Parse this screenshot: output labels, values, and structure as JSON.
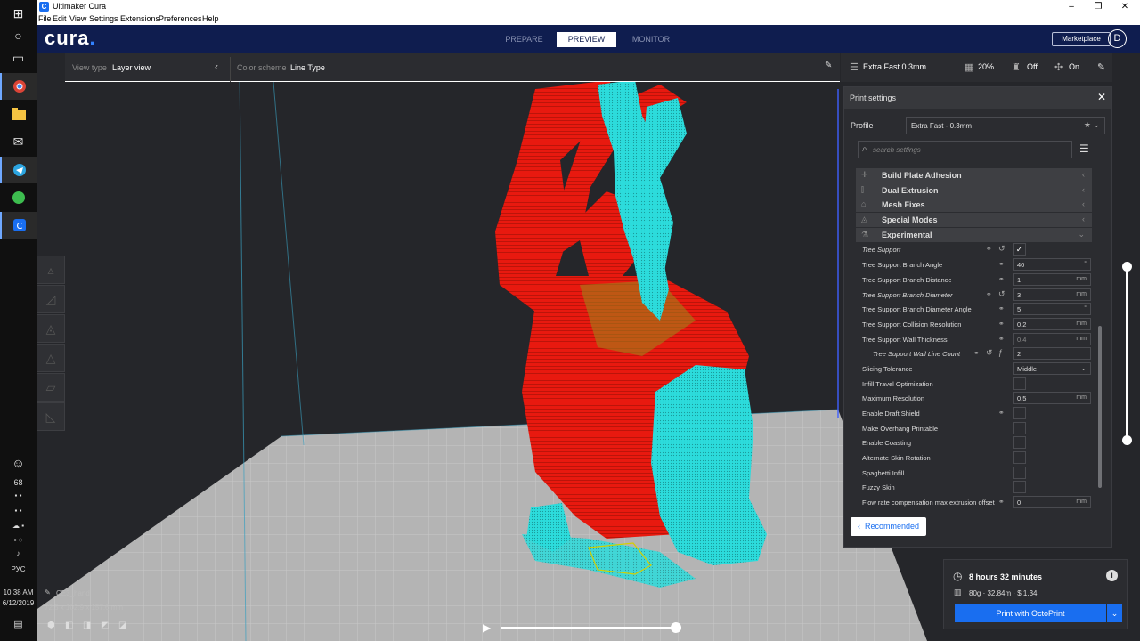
{
  "window": {
    "title": "Ultimaker Cura"
  },
  "menu": [
    "File",
    "Edit",
    "View",
    "Settings",
    "Extensions",
    "Preferences",
    "Help"
  ],
  "header": {
    "brand": "cura",
    "stages": [
      "PREPARE",
      "PREVIEW",
      "MONITOR"
    ],
    "active_stage": "PREVIEW",
    "marketplace": "Marketplace",
    "avatar": "D"
  },
  "view_toolbar": {
    "view_type_label": "View type",
    "view_type_value": "Layer view",
    "color_scheme_label": "Color scheme",
    "color_scheme_value": "Line Type"
  },
  "quick_settings": {
    "profile": "Extra Fast 0.3mm",
    "infill": "20%",
    "support": "Off",
    "adhesion": "On"
  },
  "print_settings": {
    "title": "Print settings",
    "profile_label": "Profile",
    "profile_value": "Extra Fast - 0.3mm",
    "search_placeholder": "search settings",
    "categories": [
      {
        "label": "Build Plate Adhesion",
        "icon": "adhesion-icon"
      },
      {
        "label": "Dual Extrusion",
        "icon": "dual-extrusion-icon"
      },
      {
        "label": "Mesh Fixes",
        "icon": "mesh-fixes-icon"
      },
      {
        "label": "Special Modes",
        "icon": "special-modes-icon"
      },
      {
        "label": "Experimental",
        "icon": "experimental-icon"
      }
    ],
    "rows": [
      {
        "label": "Tree Support",
        "value": "",
        "unit": ""
      },
      {
        "label": "Tree Support Branch Angle",
        "value": "40",
        "unit": "°"
      },
      {
        "label": "Tree Support Branch Distance",
        "value": "1",
        "unit": "mm"
      },
      {
        "label": "Tree Support Branch Diameter",
        "value": "3",
        "unit": "mm"
      },
      {
        "label": "Tree Support Branch Diameter Angle",
        "value": "5",
        "unit": "°"
      },
      {
        "label": "Tree Support Collision Resolution",
        "value": "0.2",
        "unit": "mm"
      },
      {
        "label": "Tree Support Wall Thickness",
        "value": "0.4",
        "unit": "mm"
      },
      {
        "label": "Tree Support Wall Line Count",
        "value": "2",
        "unit": ""
      },
      {
        "label": "Slicing Tolerance",
        "value": "Middle",
        "unit": ""
      },
      {
        "label": "Infill Travel Optimization",
        "value": "",
        "unit": ""
      },
      {
        "label": "Maximum Resolution",
        "value": "0.5",
        "unit": "mm"
      },
      {
        "label": "Enable Draft Shield",
        "value": "",
        "unit": ""
      },
      {
        "label": "Make Overhang Printable",
        "value": "",
        "unit": ""
      },
      {
        "label": "Enable Coasting",
        "value": "",
        "unit": ""
      },
      {
        "label": "Alternate Skin Rotation",
        "value": "",
        "unit": ""
      },
      {
        "label": "Spaghetti Infill",
        "value": "",
        "unit": ""
      },
      {
        "label": "Fuzzy Skin",
        "value": "",
        "unit": ""
      },
      {
        "label": "Flow rate compensation max extrusion offset",
        "value": "0",
        "unit": "mm"
      }
    ],
    "recommended": "Recommended"
  },
  "estimate": {
    "time": "8 hours 32 minutes",
    "material": "80g · 32.84m · $ 1.34",
    "print_button": "Print with OctoPrint"
  },
  "object": {
    "name": "CE3_hand",
    "dims": "72.5 x 102.9 x 157.6 mm"
  },
  "tray": {
    "temp": "68",
    "lang": "РУС",
    "time": "10:38 AM",
    "date": "6/12/2019"
  },
  "colors": {
    "header": "#0f1d4f",
    "accent": "#196ef0",
    "wall": "#e8190f",
    "support": "#2cdcdc"
  }
}
